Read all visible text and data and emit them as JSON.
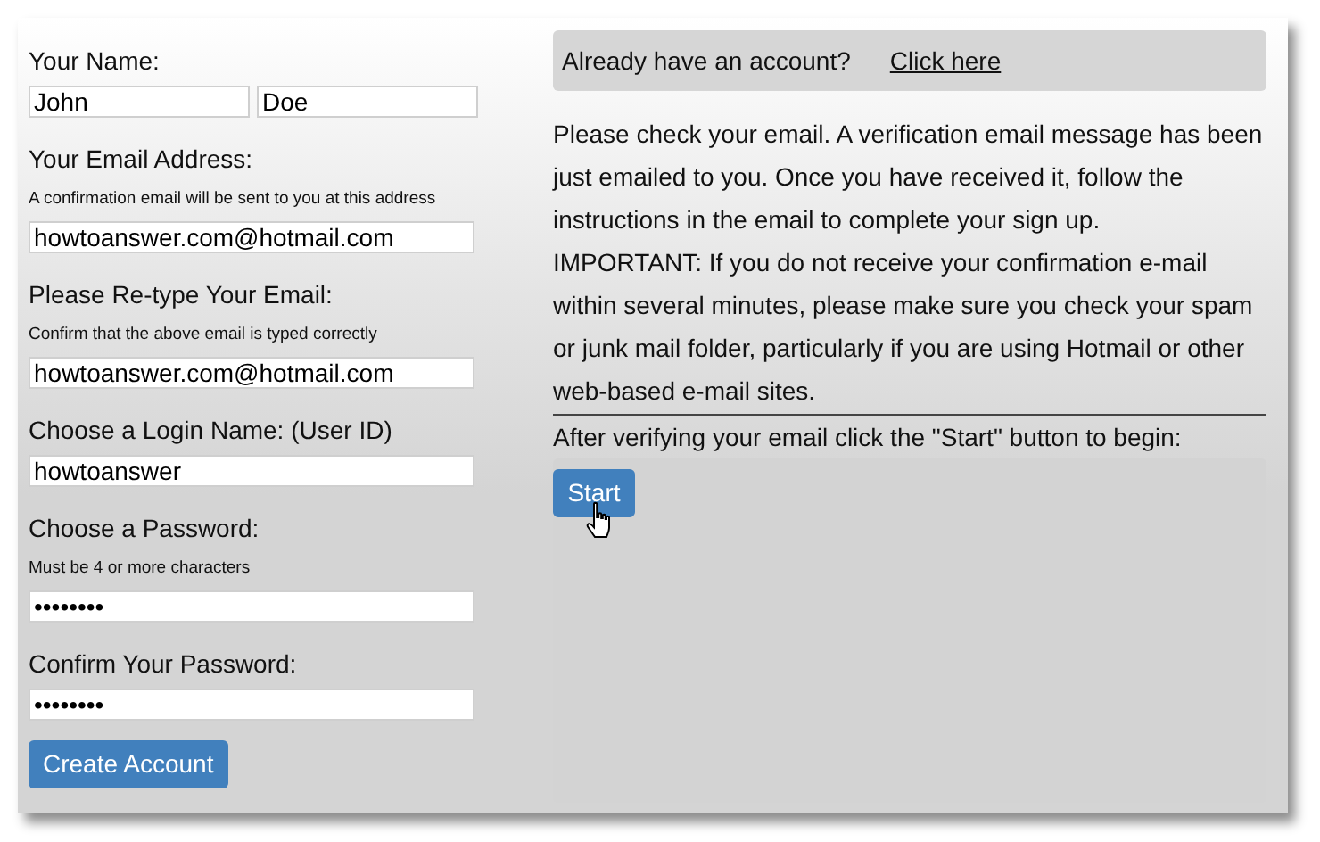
{
  "form": {
    "fields": [
      {
        "label": "Your Name:",
        "inputs": [
          {
            "value": "John"
          },
          {
            "value": "Doe"
          }
        ]
      },
      {
        "label": "Your Email Address:",
        "hint": "A confirmation email will be sent to you at this address",
        "inputs": [
          {
            "value": "howtoanswer.com@hotmail.com"
          }
        ]
      },
      {
        "label": "Please Re-type Your Email:",
        "hint": "Confirm that the above email is typed correctly",
        "inputs": [
          {
            "value": "howtoanswer.com@hotmail.com"
          }
        ]
      },
      {
        "label": "Choose a Login Name: (User ID)",
        "inputs": [
          {
            "value": "howtoanswer"
          }
        ]
      },
      {
        "label": "Choose a Password:",
        "hint": "Must be 4 or more characters",
        "inputs": [
          {
            "value": "••••••••"
          }
        ]
      },
      {
        "label": "Confirm Your Password:",
        "inputs": [
          {
            "value": "••••••••"
          }
        ]
      }
    ],
    "button": "Create Account"
  },
  "account_bar": {
    "text": "Already have an account?",
    "link": "Click here"
  },
  "message": [
    "Please check your email. A verification email message has been just emailed to you. Once you have received it, follow the instructions in the email to complete your sign up.",
    "IMPORTANT: If you do not receive your confirmation e-mail within several minutes, please make sure you check your spam or junk mail folder, particularly if you are using Hotmail or other web-based e-mail sites."
  ],
  "instruction": "After verifying your email click the \"Start\" button to begin:",
  "start_button": "Start"
}
